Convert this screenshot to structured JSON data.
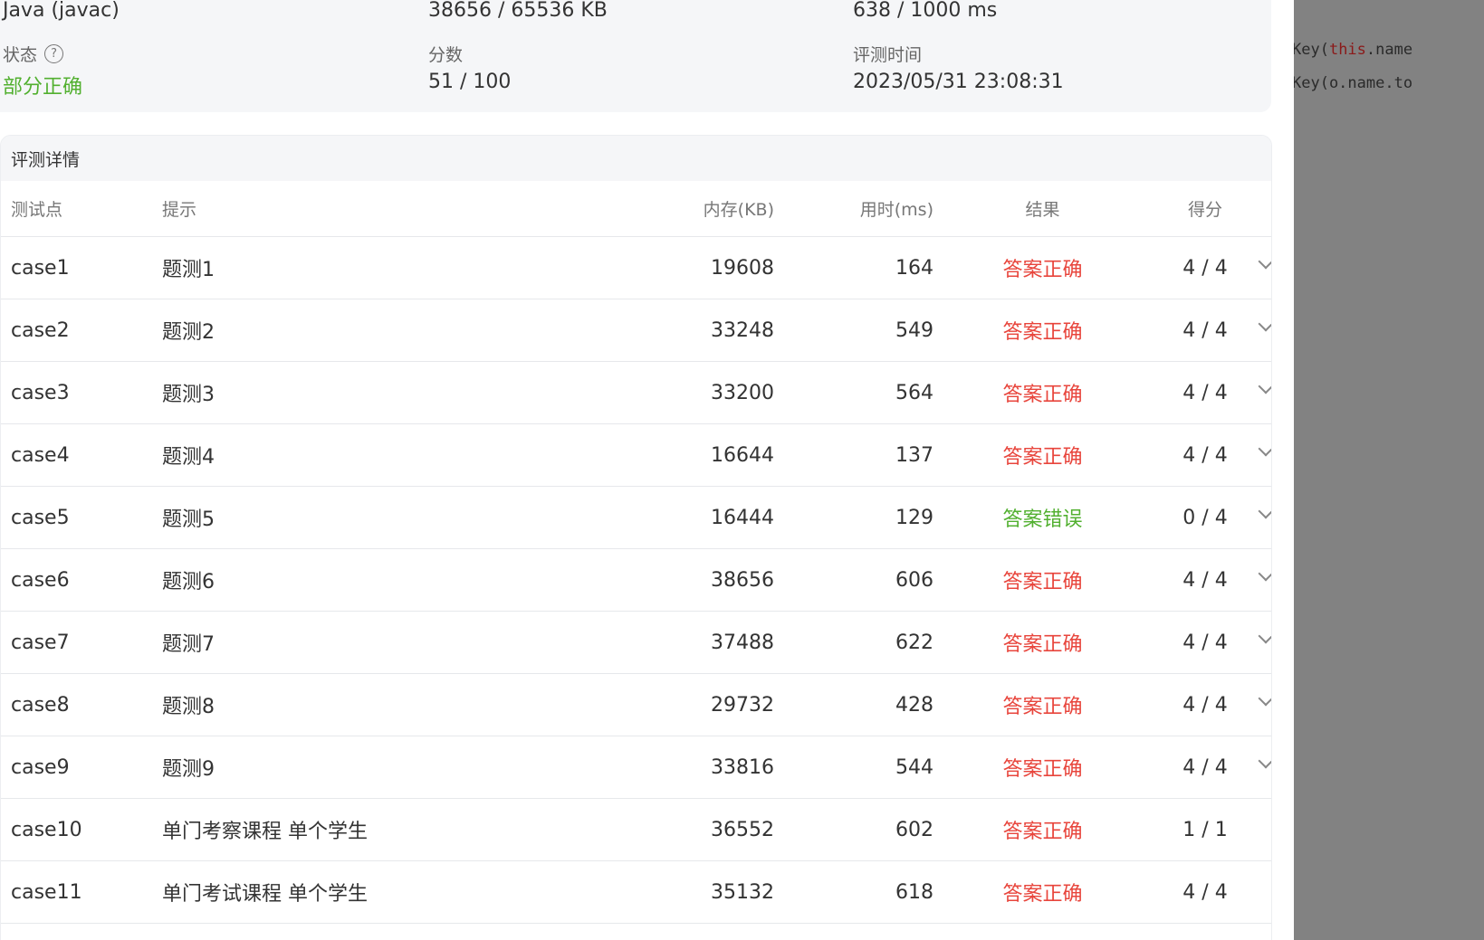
{
  "summary": {
    "language": "Java (javac)",
    "memory": "38656 / 65536 KB",
    "time": "638 / 1000 ms",
    "status_label": "状态",
    "status_value": "部分正确",
    "score_label": "分数",
    "score_value": "51 / 100",
    "judge_time_label": "评测时间",
    "judge_time_value": "2023/05/31 23:08:31",
    "status_color": "#52b030"
  },
  "details": {
    "title": "评测详情",
    "columns": {
      "id": "测试点",
      "hint": "提示",
      "memory": "内存(KB)",
      "time": "用时(ms)",
      "result": "结果",
      "score": "得分"
    },
    "rows": [
      {
        "id": "case1",
        "hint": "题测1",
        "memory": "19608",
        "time": "164",
        "result": "答案正确",
        "score": "4 / 4",
        "expandable": true
      },
      {
        "id": "case2",
        "hint": "题测2",
        "memory": "33248",
        "time": "549",
        "result": "答案正确",
        "score": "4 / 4",
        "expandable": true
      },
      {
        "id": "case3",
        "hint": "题测3",
        "memory": "33200",
        "time": "564",
        "result": "答案正确",
        "score": "4 / 4",
        "expandable": true
      },
      {
        "id": "case4",
        "hint": "题测4",
        "memory": "16644",
        "time": "137",
        "result": "答案正确",
        "score": "4 / 4",
        "expandable": true
      },
      {
        "id": "case5",
        "hint": "题测5",
        "memory": "16444",
        "time": "129",
        "result": "答案错误",
        "score": "0 / 4",
        "expandable": true
      },
      {
        "id": "case6",
        "hint": "题测6",
        "memory": "38656",
        "time": "606",
        "result": "答案正确",
        "score": "4 / 4",
        "expandable": true
      },
      {
        "id": "case7",
        "hint": "题测7",
        "memory": "37488",
        "time": "622",
        "result": "答案正确",
        "score": "4 / 4",
        "expandable": true
      },
      {
        "id": "case8",
        "hint": "题测8",
        "memory": "29732",
        "time": "428",
        "result": "答案正确",
        "score": "4 / 4",
        "expandable": true
      },
      {
        "id": "case9",
        "hint": "题测9",
        "memory": "33816",
        "time": "544",
        "result": "答案正确",
        "score": "4 / 4",
        "expandable": true
      },
      {
        "id": "case10",
        "hint": "单门考察课程 单个学生",
        "memory": "36552",
        "time": "602",
        "result": "答案正确",
        "score": "1 / 1",
        "expandable": false
      },
      {
        "id": "case11",
        "hint": "单门考试课程 单个学生",
        "memory": "35132",
        "time": "618",
        "result": "答案正确",
        "score": "4 / 4",
        "expandable": false
      }
    ],
    "result_colors": {
      "答案正确": "#e8453c",
      "答案错误": "#52b030"
    }
  },
  "code_panel": {
    "line1_prefix": "Key(",
    "line1_keyword": "this",
    "line1_suffix": ".name",
    "line2": "Key(o.name.to"
  }
}
